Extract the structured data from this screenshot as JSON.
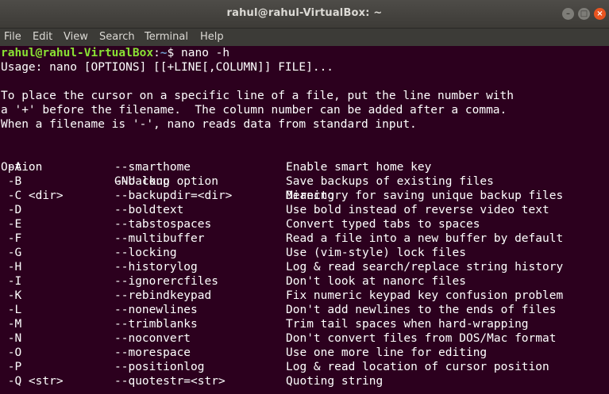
{
  "window": {
    "title": "rahul@rahul-VirtualBox: ~",
    "controls": {
      "minimize": "–",
      "maximize": "□",
      "close": "×"
    }
  },
  "menubar": [
    "File",
    "Edit",
    "View",
    "Search",
    "Terminal",
    "Help"
  ],
  "terminal": {
    "prompt": {
      "user_host": "rahul@rahul-VirtualBox",
      "separator": ":",
      "path": "~",
      "symbol": "$",
      "command": "nano -h"
    },
    "usage": "Usage: nano [OPTIONS] [[+LINE[,COLUMN]] FILE]...",
    "description": [
      "To place the cursor on a specific line of a file, put the line number with",
      "a '+' before the filename.  The column number can be added after a comma.",
      "When a filename is '-', nano reads data from standard input."
    ],
    "headers": {
      "option": "Option",
      "long": "GNU long option",
      "meaning": "Meaning"
    },
    "options": [
      {
        "opt": " -A",
        "long": "--smarthome",
        "meaning": "Enable smart home key"
      },
      {
        "opt": " -B",
        "long": "--backup",
        "meaning": "Save backups of existing files"
      },
      {
        "opt": " -C <dir>",
        "long": "--backupdir=<dir>",
        "meaning": "Directory for saving unique backup files"
      },
      {
        "opt": " -D",
        "long": "--boldtext",
        "meaning": "Use bold instead of reverse video text"
      },
      {
        "opt": " -E",
        "long": "--tabstospaces",
        "meaning": "Convert typed tabs to spaces"
      },
      {
        "opt": " -F",
        "long": "--multibuffer",
        "meaning": "Read a file into a new buffer by default"
      },
      {
        "opt": " -G",
        "long": "--locking",
        "meaning": "Use (vim-style) lock files"
      },
      {
        "opt": " -H",
        "long": "--historylog",
        "meaning": "Log & read search/replace string history"
      },
      {
        "opt": " -I",
        "long": "--ignorercfiles",
        "meaning": "Don't look at nanorc files"
      },
      {
        "opt": " -K",
        "long": "--rebindkeypad",
        "meaning": "Fix numeric keypad key confusion problem"
      },
      {
        "opt": " -L",
        "long": "--nonewlines",
        "meaning": "Don't add newlines to the ends of files"
      },
      {
        "opt": " -M",
        "long": "--trimblanks",
        "meaning": "Trim tail spaces when hard-wrapping"
      },
      {
        "opt": " -N",
        "long": "--noconvert",
        "meaning": "Don't convert files from DOS/Mac format"
      },
      {
        "opt": " -O",
        "long": "--morespace",
        "meaning": "Use one more line for editing"
      },
      {
        "opt": " -P",
        "long": "--positionlog",
        "meaning": "Log & read location of cursor position"
      },
      {
        "opt": " -Q <str>",
        "long": "--quotestr=<str>",
        "meaning": "Quoting string"
      }
    ]
  },
  "colors": {
    "terminal_bg": "#2c001e",
    "prompt_user": "#8ae234",
    "prompt_path": "#729fcf",
    "titlebar": "#3c3b37",
    "close_button": "#e95420"
  }
}
